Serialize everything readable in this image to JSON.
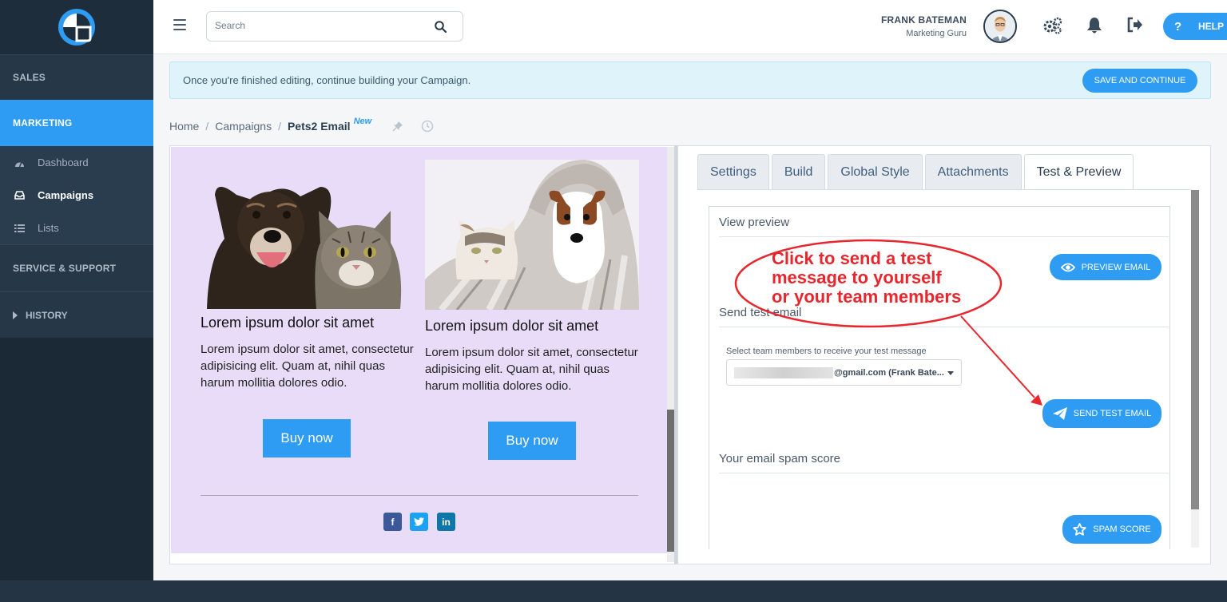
{
  "sidebar": {
    "sections": {
      "sales": "SALES",
      "marketing": "MARKETING",
      "service": "SERVICE & SUPPORT",
      "history": "HISTORY"
    },
    "items": [
      {
        "label": "Dashboard",
        "icon": "dashboard-icon"
      },
      {
        "label": "Campaigns",
        "icon": "inbox-icon",
        "active": true
      },
      {
        "label": "Lists",
        "icon": "list-icon"
      }
    ]
  },
  "header": {
    "search_placeholder": "Search",
    "user_name": "FRANK BATEMAN",
    "user_role": "Marketing Guru",
    "help_label": "HELP"
  },
  "banner": {
    "message": "Once you're finished editing, continue building your Campaign.",
    "save_label": "SAVE AND CONTINUE"
  },
  "breadcrumb": {
    "home": "Home",
    "campaigns": "Campaigns",
    "current": "Pets2 Email",
    "badge": "New"
  },
  "email": {
    "products": [
      {
        "title": "Lorem ipsum dolor sit amet",
        "description": "Lorem ipsum dolor sit amet, consectetur adipisicing elit. Quam at, nihil quas harum mollitia dolores odio.",
        "button": "Buy now"
      },
      {
        "title": "Lorem ipsum dolor sit amet",
        "description": "Lorem ipsum dolor sit amet, consectetur adipisicing elit. Quam at, nihil quas harum mollitia dolores odio.",
        "button": "Buy now"
      }
    ],
    "social": {
      "facebook": "f",
      "linkedin": "in"
    }
  },
  "tabs": [
    "Settings",
    "Build",
    "Global Style",
    "Attachments",
    "Test & Preview"
  ],
  "test_preview": {
    "view_preview_title": "View preview",
    "preview_button": "PREVIEW EMAIL",
    "send_test_title": "Send test email",
    "select_label": "Select team members to receive your test message",
    "select_value": "@gmail.com (Frank Bate...",
    "send_button": "SEND TEST EMAIL",
    "spam_title": "Your email spam score",
    "spam_button": "SPAM SCORE"
  },
  "annotation": {
    "line1": "Click to send a test",
    "line2": "message to yourself",
    "line3": "or your team members"
  },
  "colors": {
    "accent": "#2e9cf3",
    "sidebar": "#1e2d3b",
    "email_bg": "#e8dcf8",
    "annotation": "#e8262d"
  }
}
